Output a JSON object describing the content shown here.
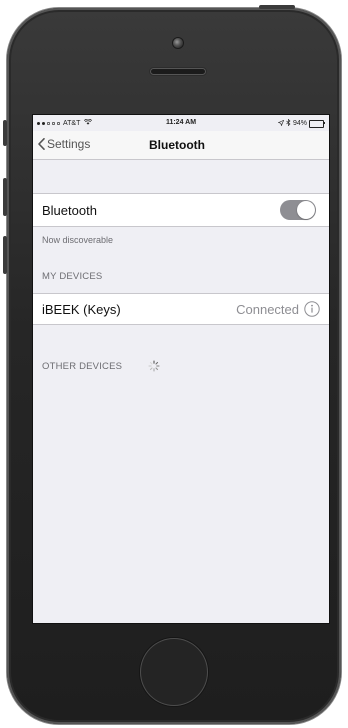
{
  "status_bar": {
    "carrier": "AT&T",
    "time": "11:24 AM",
    "battery": "94%",
    "battery_level": 0.94
  },
  "nav": {
    "back_label": "Settings",
    "title": "Bluetooth"
  },
  "bluetooth_row": {
    "label": "Bluetooth",
    "toggle_on": true
  },
  "discoverable_note": "Now discoverable",
  "my_devices": {
    "header": "MY DEVICES",
    "devices": [
      {
        "name": "iBEEK (Keys)",
        "status": "Connected"
      }
    ]
  },
  "other_devices": {
    "header": "OTHER DEVICES"
  },
  "colors": {
    "screen_bg": "#efeff4",
    "toggle_track": "#8e8e93",
    "secondary_text": "#8e8e93"
  }
}
